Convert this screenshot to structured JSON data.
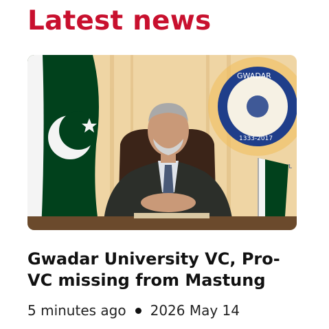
{
  "section": {
    "title": "Latest news"
  },
  "article": {
    "headline": "Gwadar University VC, Pro-VC missing from Mastung",
    "time_ago": "5 minutes ago",
    "date": "2026 May 14",
    "image": {
      "emblem_text": "GWADAR",
      "emblem_year": "1333-2017",
      "emblem_bottom": "KNOWL"
    }
  },
  "colors": {
    "accent": "#c8102e",
    "text": "#111111",
    "flag_green": "#01411c"
  }
}
